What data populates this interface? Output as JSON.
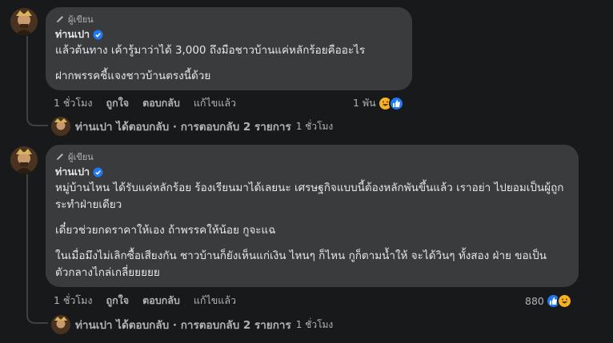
{
  "comments": [
    {
      "role": "ผู้เขียน",
      "author": "ท่านเปา",
      "paragraphs": [
        "แล้วต้นทาง เค้ารู้มาว่าได้ 3,000 ถึงมือชาวบ้านแค่หลักร้อยคืออะไร",
        "ฝากพรรคชี้แจงชาวบ้านตรงนี้ด้วย"
      ],
      "actions": {
        "time": "1 ชั่วโมง",
        "like": "ถูกใจ",
        "reply": "ตอบกลับ",
        "edit": "แก้ไขแล้ว"
      },
      "reactions": {
        "count": "1 พัน",
        "icons": [
          "haha-reaction-icon",
          "like-reaction-icon"
        ]
      },
      "reply_summary": {
        "text": "ท่านเปา ได้ตอบกลับ · การตอบกลับ 2 รายการ",
        "time": "1 ชั่วโมง"
      }
    },
    {
      "role": "ผู้เขียน",
      "author": "ท่านเปา",
      "paragraphs": [
        "หมู่บ้านไหน ได้รับแค่หลักร้อย ร้องเรียนมาได้เลยนะ เศรษฐกิจแบบนี้ต้องหลักพันขึ้นแล้ว เราอย่า ไปยอมเป็นผู้ถูกระทำฝ่ายเดียว",
        "เดี๋ยวช่วยกดราคาให้เอง ถ้าพรรคให้น้อย กูจะแฉ",
        "ในเมื่อมึงไม่เลิกซื้อเสียงกัน ชาวบ้านก็ยังเห็นแก่เงิน ไหนๆ ก็ไหน กูก็ตามน้ำให้ จะได้วินๆ ทั้งสอง ฝ่าย ขอเป็นตัวกลางไกล่เกลี่ยยยยย"
      ],
      "actions": {
        "time": "1 ชั่วโมง",
        "like": "ถูกใจ",
        "reply": "ตอบกลับ",
        "edit": "แก้ไขแล้ว"
      },
      "reactions": {
        "count": "880",
        "icons": [
          "like-reaction-icon",
          "haha-reaction-icon"
        ]
      },
      "reply_summary": {
        "text": "ท่านเปา ได้ตอบกลับ · การตอบกลับ 2 รายการ",
        "time": "1 ชั่วโมง"
      }
    }
  ],
  "colors": {
    "background": "#18191a",
    "bubble": "#3a3b3c",
    "verified": "#2078f4",
    "secondary_text": "#b0b3b8"
  }
}
